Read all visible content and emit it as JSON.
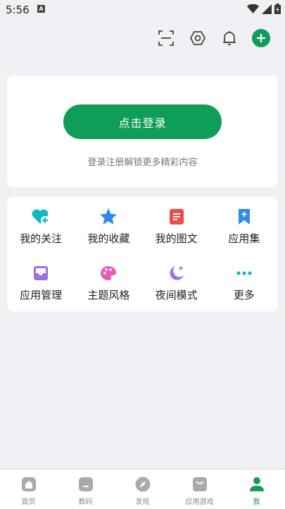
{
  "status_bar": {
    "time": "5:56",
    "a_badge": "A"
  },
  "header": {
    "icons": [
      "scan-icon",
      "settings-icon",
      "bell-icon",
      "add-icon"
    ],
    "accent_color": "#109d58"
  },
  "login": {
    "button_label": "点击登录",
    "hint": "登录注册解锁更多精彩内容"
  },
  "menu": {
    "items": [
      {
        "label": "我的关注",
        "icon": "heart-plus-icon",
        "color": "#11b7c9"
      },
      {
        "label": "我的收藏",
        "icon": "star-icon",
        "color": "#2f8be8"
      },
      {
        "label": "我的图文",
        "icon": "document-icon",
        "color": "#ef4b45"
      },
      {
        "label": "应用集",
        "icon": "bookmark-plus-icon",
        "color": "#2f8be8"
      },
      {
        "label": "应用管理",
        "icon": "inbox-icon",
        "color": "#a06fe6"
      },
      {
        "label": "主题风格",
        "icon": "palette-icon",
        "color": "#e75bb8"
      },
      {
        "label": "夜间模式",
        "icon": "moon-icon",
        "color": "#a06fe6"
      },
      {
        "label": "更多",
        "icon": "more-icon",
        "color": "#18b6c4"
      }
    ]
  },
  "bottom_nav": {
    "items": [
      {
        "label": "首页",
        "icon": "home-icon"
      },
      {
        "label": "数码",
        "icon": "phone-icon"
      },
      {
        "label": "发现",
        "icon": "compass-icon"
      },
      {
        "label": "应用游戏",
        "icon": "bag-icon"
      },
      {
        "label": "我",
        "icon": "person-icon",
        "active": true
      }
    ]
  }
}
